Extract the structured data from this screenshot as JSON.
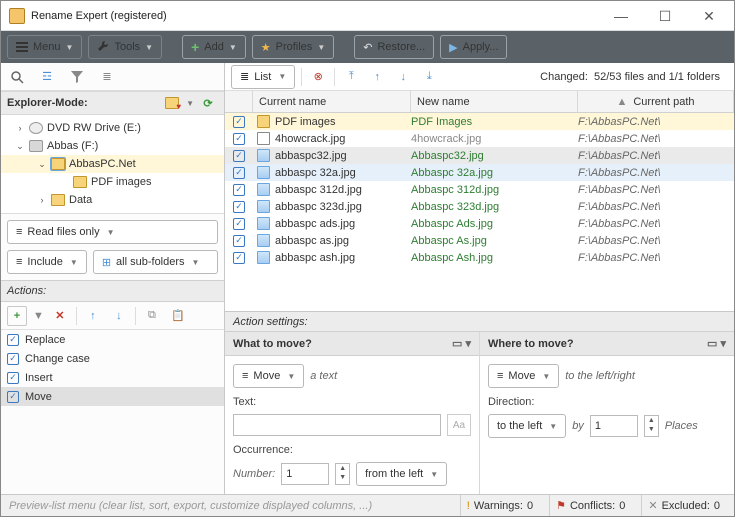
{
  "window": {
    "title": "Rename Expert (registered)"
  },
  "toolbar": {
    "menu": "Menu",
    "tools": "Tools",
    "add": "Add",
    "profiles": "Profiles",
    "restore": "Restore...",
    "apply": "Apply..."
  },
  "explorer": {
    "title": "Explorer-Mode:",
    "nodes": {
      "dvd": "DVD RW Drive (E:)",
      "abbas": "Abbas (F:)",
      "abbaspc": "AbbasPC.Net",
      "pdfimages": "PDF images",
      "data": "Data"
    },
    "read_files": "Read files only",
    "include": "Include",
    "subfolders": "all sub-folders"
  },
  "actions": {
    "title": "Actions:",
    "items": [
      "Replace",
      "Change case",
      "Insert",
      "Move"
    ]
  },
  "list": {
    "list_btn": "List",
    "changed_lbl": "Changed:",
    "changed_val": "52/53 files and 1/1 folders",
    "cols": {
      "cur": "Current name",
      "new": "New name",
      "path": "Current path"
    },
    "rows": [
      {
        "cur": "PDF images",
        "new": "PDF Images",
        "path": "F:\\AbbasPC.Net\\",
        "type": "folder",
        "hl": "yellow",
        "green": true
      },
      {
        "cur": "4howcrack.jpg",
        "new": "4howcrack.jpg",
        "path": "F:\\AbbasPC.Net\\",
        "type": "pdf",
        "green": false
      },
      {
        "cur": "abbaspc32.jpg",
        "new": "Abbaspc32.jpg",
        "path": "F:\\AbbasPC.Net\\",
        "type": "img",
        "hl": "grey",
        "green": true
      },
      {
        "cur": "abbaspc 32a.jpg",
        "new": "Abbaspc 32a.jpg",
        "path": "F:\\AbbasPC.Net\\",
        "type": "img",
        "hl": "blue",
        "green": true
      },
      {
        "cur": "abbaspc 312d.jpg",
        "new": "Abbaspc 312d.jpg",
        "path": "F:\\AbbasPC.Net\\",
        "type": "img",
        "green": true
      },
      {
        "cur": "abbaspc 323d.jpg",
        "new": "Abbaspc 323d.jpg",
        "path": "F:\\AbbasPC.Net\\",
        "type": "img",
        "green": true
      },
      {
        "cur": "abbaspc ads.jpg",
        "new": "Abbaspc Ads.jpg",
        "path": "F:\\AbbasPC.Net\\",
        "type": "img",
        "green": true
      },
      {
        "cur": "abbaspc as.jpg",
        "new": "Abbaspc As.jpg",
        "path": "F:\\AbbasPC.Net\\",
        "type": "img",
        "green": true
      },
      {
        "cur": "abbaspc ash.jpg",
        "new": "Abbaspc Ash.jpg",
        "path": "F:\\AbbasPC.Net\\",
        "type": "img",
        "green": true
      }
    ]
  },
  "settings": {
    "title": "Action settings:",
    "what": {
      "title": "What to move?",
      "move": "Move",
      "hint": "a text",
      "text_lbl": "Text:",
      "occ_lbl": "Occurrence:",
      "number_lbl": "Number:",
      "number_val": "1",
      "from": "from the left"
    },
    "where": {
      "title": "Where to move?",
      "move": "Move",
      "hint": "to the left/right",
      "dir_lbl": "Direction:",
      "dir_val": "to the left",
      "by": "by",
      "by_val": "1",
      "places": "Places"
    }
  },
  "status": {
    "hint": "Preview-list menu (clear list, sort, export, customize displayed columns, ...)",
    "warnings_lbl": "Warnings:",
    "warnings_val": "0",
    "conflicts_lbl": "Conflicts:",
    "conflicts_val": "0",
    "excluded_lbl": "Excluded:",
    "excluded_val": "0"
  }
}
